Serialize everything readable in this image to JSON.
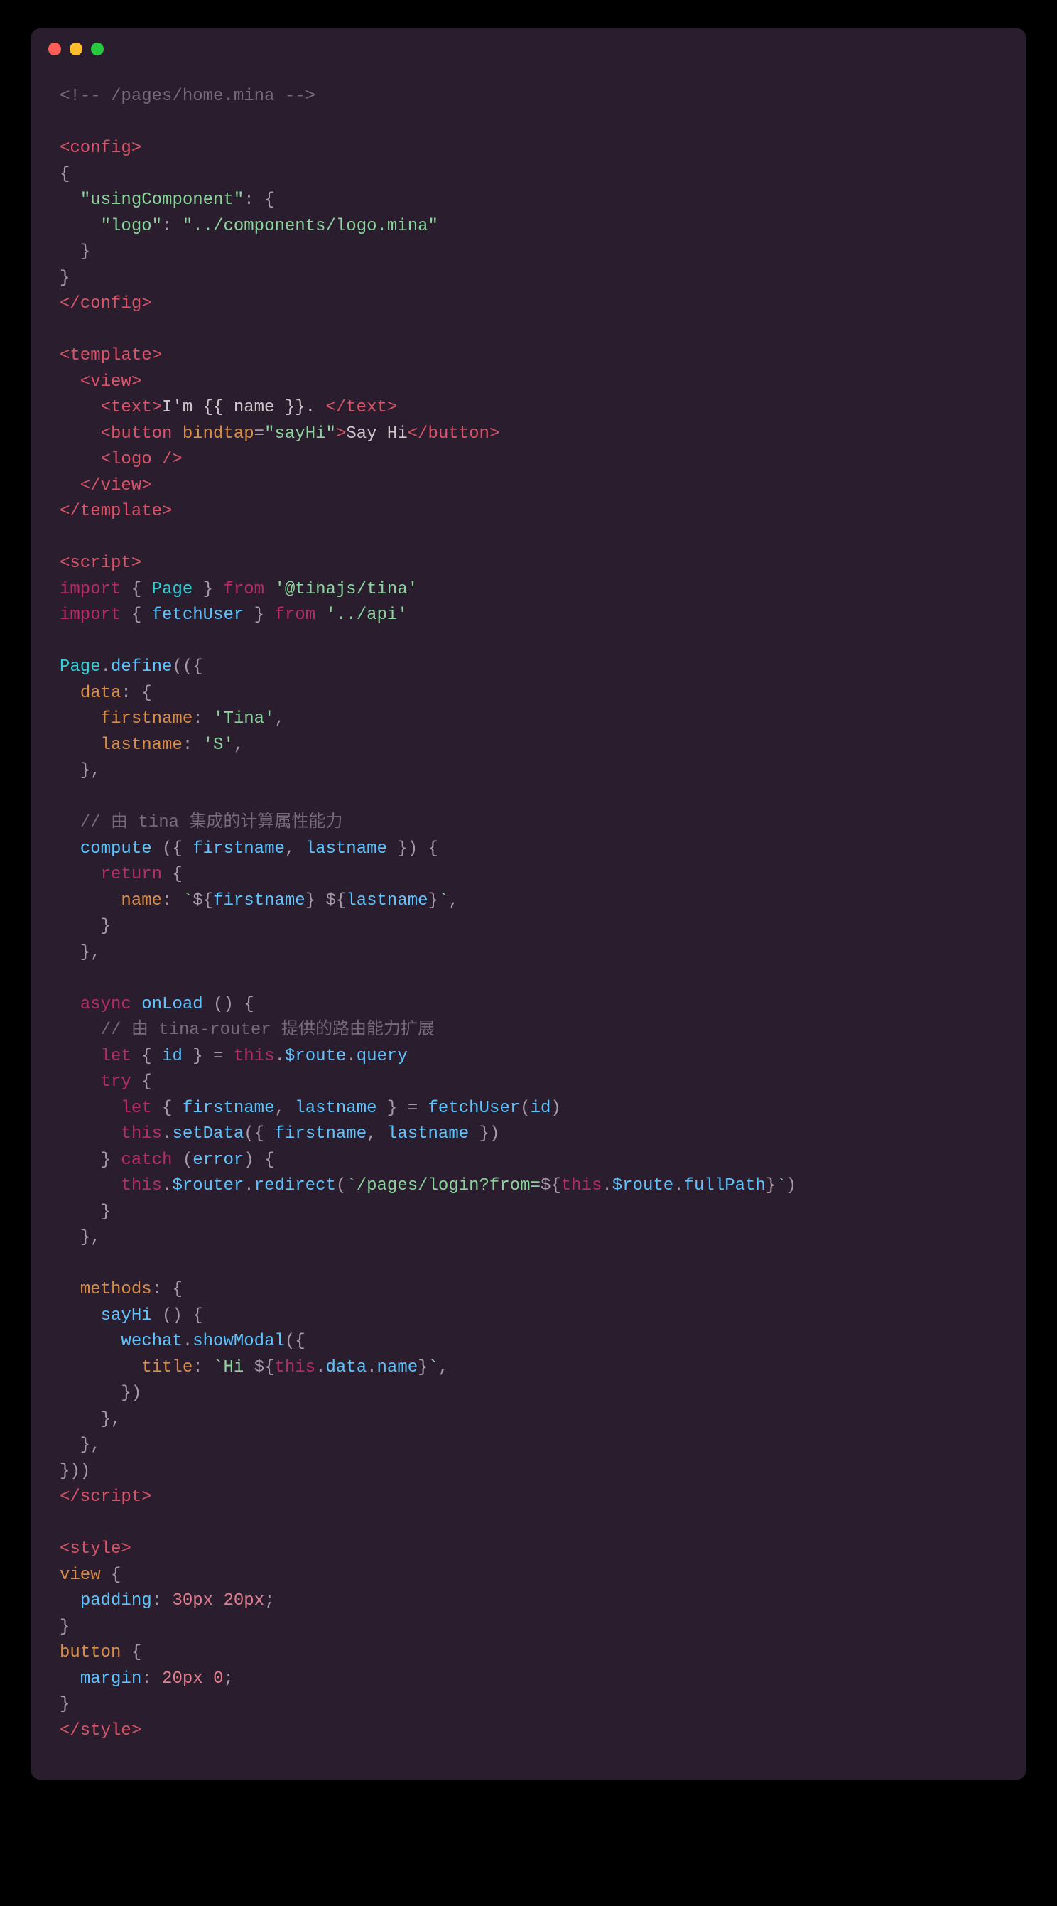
{
  "code": {
    "filepath": "/pages/home.mina",
    "config": {
      "usingComponentKey": "usingComponent",
      "logoKey": "logo",
      "logoPath": "../components/logo.mina"
    },
    "template": {
      "textContent": "I'm {{ name }}. ",
      "buttonAttr": "bindtap",
      "buttonHandler": "sayHi",
      "buttonLabel": "Say Hi"
    },
    "script": {
      "importPage": "Page",
      "importTina": "'@tinajs/tina'",
      "importFetchUser": "fetchUser",
      "importApi": "'../api'",
      "dataKey": "data",
      "firstnameKey": "firstname",
      "firstnameVal": "'Tina'",
      "lastnameKey": "lastname",
      "lastnameVal": "'S'",
      "computeComment": "// 由 tina 集成的计算属性能力",
      "computeName": "compute",
      "nameKey": "name",
      "onLoadName": "onLoad",
      "onLoadComment": "// 由 tina-router 提供的路由能力扩展",
      "idVar": "id",
      "routeQuery": "$route",
      "queryProp": "query",
      "fetchUserCall": "fetchUser",
      "setDataCall": "setData",
      "errorVar": "error",
      "routerProp": "$router",
      "redirectCall": "redirect",
      "redirectPath": "/pages/login?from=",
      "fullPathProp": "fullPath",
      "methodsKey": "methods",
      "sayHiName": "sayHi",
      "wechatVar": "wechat",
      "showModalCall": "showModal",
      "titleKey": "title",
      "hiPrefix": "Hi "
    },
    "style": {
      "viewSelector": "view",
      "paddingProp": "padding",
      "paddingVal1": "30px",
      "paddingVal2": "20px",
      "buttonSelector": "button",
      "marginProp": "margin",
      "marginVal1": "20px",
      "marginVal2": "0"
    }
  }
}
